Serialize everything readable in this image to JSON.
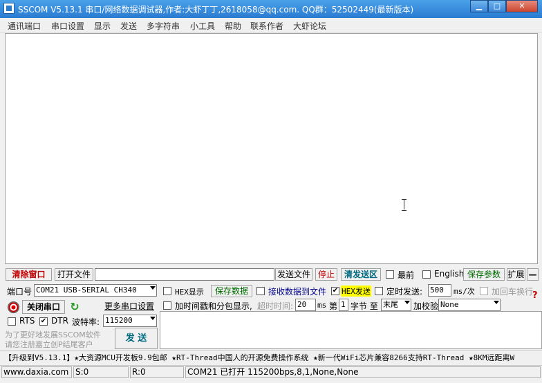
{
  "window": {
    "title": "SSCOM V5.13.1 串口/网络数据调试器,作者:大虾丁丁,2618058@qq.com. QQ群：52502449(最新版本)"
  },
  "menu": [
    "通讯端口",
    "串口设置",
    "显示",
    "发送",
    "多字符串",
    "小工具",
    "帮助",
    "联系作者",
    "大虾论坛"
  ],
  "toolbar": {
    "clear": "清除窗口",
    "open_file": "打开文件",
    "file_path": "",
    "send_file": "发送文件",
    "stop": "停止",
    "clear_send": "清发送区",
    "topmost": "最前",
    "english": "English",
    "save_params": "保存参数",
    "expand": "扩展",
    "collapse": "—"
  },
  "port": {
    "label": "端口号",
    "value": "COM21 USB-SERIAL CH340",
    "close_btn": "关闭串口",
    "more_settings": "更多串口设置",
    "rts": "RTS",
    "dtr": "DTR",
    "baud_label": "波特率:",
    "baud": "115200"
  },
  "options": {
    "hex_display": "HEX显示",
    "save_data": "保存数据",
    "recv_to_file": "接收数据到文件",
    "hex_send": "HEX发送",
    "timed_send": "定时发送:",
    "interval": "500",
    "interval_unit": "ms/次",
    "add_crlf": "加回车换行",
    "timestamp": "加时间戳和分包显示,",
    "timeout_label": "超时时间:",
    "timeout": "20",
    "ms": "ms",
    "di": "第",
    "byte_index": "1",
    "byte_to": "字节 至",
    "end": "末尾",
    "checksum_label": "加校验",
    "checksum": "None",
    "help": "?"
  },
  "promo": {
    "line1": "为了更好地发展SSCOM软件",
    "line2": "请您注册嘉立创P结尾客户"
  },
  "send_btn": "发 送",
  "ticker": "【升级到V5.13.1】★大资源MCU开发板9.9包邮 ★RT-Thread中国人的开源免费操作系统 ★新一代WiFi芯片兼容8266支持RT-Thread ★8KM远距离W",
  "status": {
    "site": "www.daxia.com",
    "sent": "S:0",
    "recv": "R:0",
    "port_state": "COM21 已打开  115200bps,8,1,None,None"
  }
}
